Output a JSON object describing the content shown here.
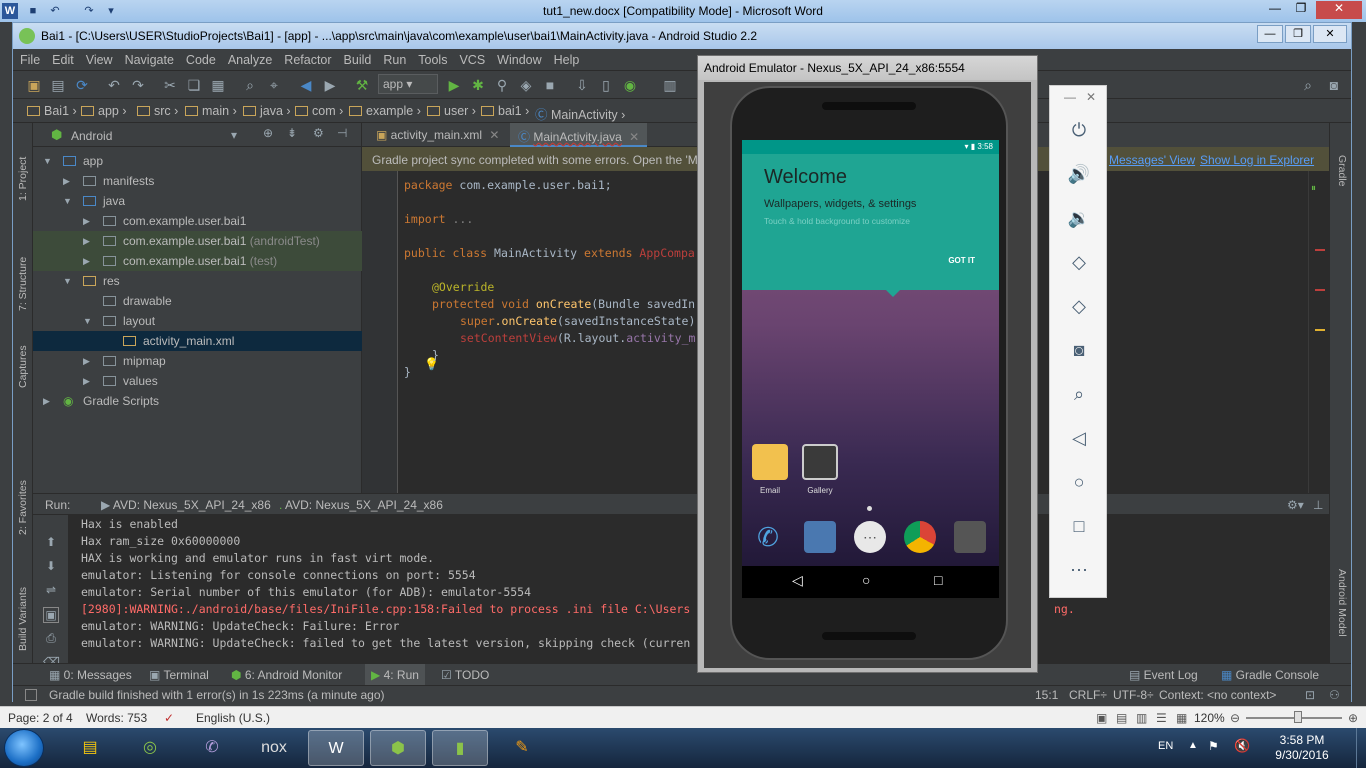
{
  "word": {
    "title": "tut1_new.docx [Compatibility Mode]  -  Microsoft Word",
    "status": {
      "page": "Page: 2 of 4",
      "words": "Words: 753",
      "language": "English (U.S.)",
      "zoom": "120%"
    }
  },
  "studio": {
    "title": "Bai1 - [C:\\Users\\USER\\StudioProjects\\Bai1] - [app] - ...\\app\\src\\main\\java\\com\\example\\user\\bai1\\MainActivity.java - Android Studio 2.2",
    "menu": [
      "File",
      "Edit",
      "View",
      "Navigate",
      "Code",
      "Analyze",
      "Refactor",
      "Build",
      "Run",
      "Tools",
      "VCS",
      "Window",
      "Help"
    ],
    "run_config": "app",
    "breadcrumb": [
      "Bai1",
      "app",
      "src",
      "main",
      "java",
      "com",
      "example",
      "user",
      "bai1",
      "MainActivity"
    ],
    "left_stripe": [
      "1: Project",
      "7: Structure",
      "Captures",
      "2: Favorites",
      "Build Variants"
    ],
    "right_stripe": [
      "Gradle",
      "Android Model"
    ],
    "project_view": "Android",
    "tree": [
      {
        "label": "app",
        "hint": ""
      },
      {
        "label": "manifests",
        "hint": ""
      },
      {
        "label": "java",
        "hint": ""
      },
      {
        "label": "com.example.user.bai1",
        "hint": ""
      },
      {
        "label": "com.example.user.bai1",
        "hint": " (androidTest)"
      },
      {
        "label": "com.example.user.bai1",
        "hint": " (test)"
      },
      {
        "label": "res",
        "hint": ""
      },
      {
        "label": "drawable",
        "hint": ""
      },
      {
        "label": "layout",
        "hint": ""
      },
      {
        "label": "activity_main.xml",
        "hint": ""
      },
      {
        "label": "mipmap",
        "hint": ""
      },
      {
        "label": "values",
        "hint": ""
      },
      {
        "label": "Gradle Scripts",
        "hint": ""
      }
    ],
    "tabs": [
      "activity_main.xml",
      "MainActivity.java"
    ],
    "notice": {
      "text": "Gradle project sync completed with some errors. Open the 'M",
      "link1": "Messages' View",
      "link2": "Show Log in Explorer"
    },
    "code": {
      "l1_kw": "package",
      "l1_rest": " com.example.user.bai1;",
      "l2_kw": "import",
      "l2_rest": " ...",
      "l3_kw": "public class",
      "l3_name": " MainActivity ",
      "l3_kw2": "extends",
      "l3_rest": " AppCompa",
      "l4": "@Override",
      "l5_kw": "protected void",
      "l5_fn": " onCreate",
      "l5_rest": "(Bundle savedIn",
      "l6_kw": "super",
      "l6_fn": ".onCreate",
      "l6_rest": "(savedInstanceState)",
      "l7_fn": "setContentView",
      "l7_rest": "(R.layout.",
      "l7_fld": "activity_m",
      "l8": "}",
      "l9": "}"
    },
    "run": {
      "label": "Run:",
      "tab1": "AVD: Nexus_5X_API_24_x86",
      "tab2": "AVD: Nexus_5X_API_24_x86"
    },
    "console": [
      "Hax is enabled",
      "Hax ram_size 0x60000000",
      "HAX is working and emulator runs in fast virt mode.",
      "emulator: Listening for console connections on port: 5554",
      "emulator: Serial number of this emulator (for ADB): emulator-5554",
      "[2980]:WARNING:./android/base/files/IniFile.cpp:158:Failed to process .ini file C:\\Users",
      "emulator: WARNING: UpdateCheck: Failure: Error",
      "emulator: WARNING: UpdateCheck: failed to get the latest version, skipping check (curren"
    ],
    "console_tail": "ng.",
    "bottom_tabs": {
      "messages": "0: Messages",
      "terminal": "Terminal",
      "monitor": "6: Android Monitor",
      "run": "4: Run",
      "todo": "TODO",
      "event_log": "Event Log",
      "gradle_console": "Gradle Console"
    },
    "status": {
      "message": "Gradle build finished with 1 error(s) in 1s 223ms (a minute ago)",
      "position": "15:1",
      "line_sep": "CRLF÷",
      "encoding": "UTF-8÷",
      "context": "Context: <no context>"
    }
  },
  "emulator": {
    "title": "Android Emulator - Nexus_5X_API_24_x86:5554",
    "time": "3:58",
    "welcome_title": "Welcome",
    "welcome_sub": "Wallpapers, widgets, & settings",
    "welcome_hint": "Touch & hold background to customize",
    "got_it": "GOT IT",
    "apps": [
      "Email",
      "Gallery"
    ]
  },
  "taskbar": {
    "lang": "EN",
    "time": "3:58 PM",
    "date": "9/30/2016"
  }
}
